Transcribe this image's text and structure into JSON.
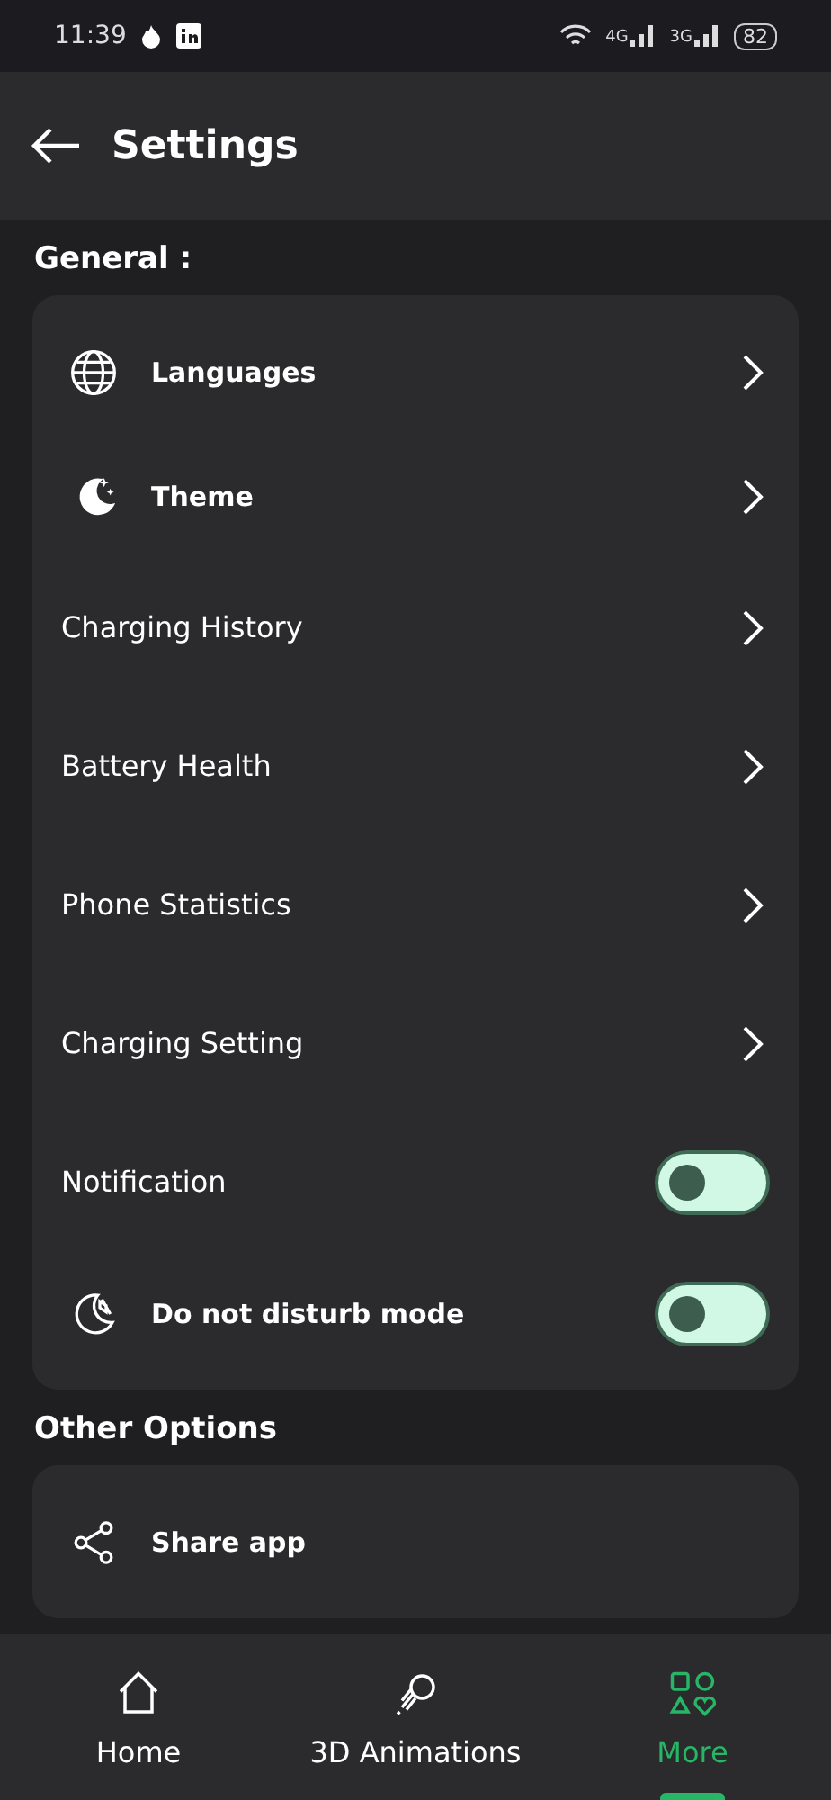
{
  "status_bar": {
    "time": "11:39",
    "sims": [
      "4G",
      "3G"
    ],
    "battery": "82"
  },
  "app_bar": {
    "title": "Settings"
  },
  "sections": [
    {
      "title": "General :",
      "items": [
        {
          "kind": "icon-link",
          "label": "Languages"
        },
        {
          "kind": "icon-link",
          "label": "Theme"
        },
        {
          "kind": "link",
          "label": "Charging History"
        },
        {
          "kind": "link",
          "label": "Battery Health"
        },
        {
          "kind": "link",
          "label": "Phone Statistics"
        },
        {
          "kind": "link",
          "label": "Charging Setting"
        },
        {
          "kind": "toggle",
          "label": "Notification",
          "on": false
        },
        {
          "kind": "icon-toggle",
          "label": "Do not disturb mode",
          "on": false
        }
      ]
    },
    {
      "title": "Other Options",
      "items": [
        {
          "kind": "icon-action",
          "label": "Share app"
        }
      ]
    }
  ],
  "nav": [
    {
      "label": "Home",
      "selected": false
    },
    {
      "label": "3D Animations",
      "selected": false
    },
    {
      "label": "More",
      "selected": true
    }
  ]
}
